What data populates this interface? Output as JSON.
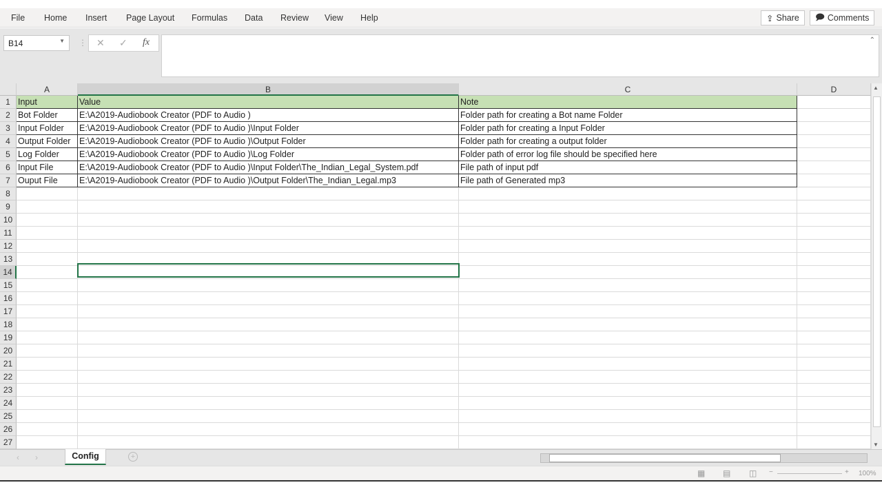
{
  "menu": [
    "File",
    "Home",
    "Insert",
    "Page Layout",
    "Formulas",
    "Data",
    "Review",
    "View",
    "Help"
  ],
  "share_label": "Share",
  "comments_label": "Comments",
  "name_box": "B14",
  "formula_value": "",
  "columns": [
    "A",
    "B",
    "C",
    "D"
  ],
  "rows": [
    [
      "Input",
      "Value",
      "Note"
    ],
    [
      "Bot Folder",
      "E:\\A2019-Audiobook Creator (PDF to Audio )",
      "Folder path  for creating a Bot name Folder"
    ],
    [
      "Input Folder",
      "E:\\A2019-Audiobook Creator (PDF to Audio )\\Input Folder",
      "Folder path  for creating a Input Folder"
    ],
    [
      "Output Folder",
      "E:\\A2019-Audiobook Creator (PDF to Audio )\\Output Folder",
      "Folder path  for creating a output folder"
    ],
    [
      "Log Folder",
      "E:\\A2019-Audiobook Creator (PDF to Audio )\\Log Folder",
      "Folder path of error log file should be specified here"
    ],
    [
      "Input File",
      "E:\\A2019-Audiobook Creator (PDF to Audio )\\Input Folder\\The_Indian_Legal_System.pdf",
      "File path of input pdf"
    ],
    [
      "Ouput File",
      "E:\\A2019-Audiobook Creator (PDF to Audio )\\Output Folder\\The_Indian_Legal.mp3",
      "File path of Generated mp3"
    ]
  ],
  "row_count": 27,
  "selected_cell": "B14",
  "sheet_tab": "Config",
  "zoom_label": "100%",
  "colors": {
    "header_fill": "#c6e0b4",
    "accent": "#217346"
  }
}
